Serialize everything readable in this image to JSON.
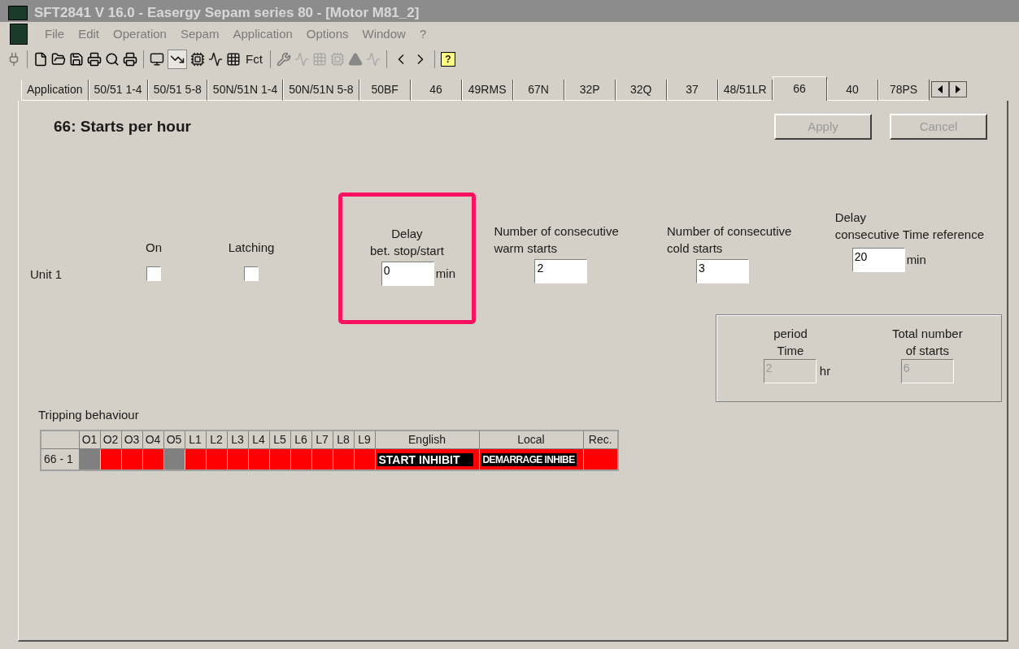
{
  "window": {
    "title": "SFT2841  V 16.0 - Easergy Sepam series 80 - [Motor M81_2]"
  },
  "menu": [
    "File",
    "Edit",
    "Operation",
    "Sepam",
    "Application",
    "Options",
    "Window",
    "?"
  ],
  "toolbar": {
    "fct_label": "Fct",
    "help_label": "?"
  },
  "tabs": [
    {
      "label": "Application",
      "selected": false
    },
    {
      "label": "50/51 1-4",
      "selected": false
    },
    {
      "label": "50/51 5-8",
      "selected": false
    },
    {
      "label": "50N/51N 1-4",
      "selected": false
    },
    {
      "label": "50N/51N 5-8",
      "selected": false
    },
    {
      "label": "50BF",
      "selected": false
    },
    {
      "label": "46",
      "selected": false
    },
    {
      "label": "49RMS",
      "selected": false
    },
    {
      "label": "67N",
      "selected": false
    },
    {
      "label": "32P",
      "selected": false
    },
    {
      "label": "32Q",
      "selected": false
    },
    {
      "label": "37",
      "selected": false
    },
    {
      "label": "48/51LR",
      "selected": false
    },
    {
      "label": "66",
      "selected": true
    },
    {
      "label": "40",
      "selected": false
    },
    {
      "label": "78PS",
      "selected": false
    }
  ],
  "heading": "66: Starts per hour",
  "buttons": [
    {
      "label": "Apply",
      "disabled": true
    },
    {
      "label": "Cancel",
      "disabled": true
    }
  ],
  "unit": {
    "label": "Unit 1"
  },
  "on": {
    "label": "On",
    "checked": false
  },
  "latching": {
    "label": "Latching",
    "checked": false
  },
  "delay_stop_start": {
    "label_lines": [
      "Delay",
      "bet. stop/start"
    ],
    "value": "0",
    "unit": "min",
    "highlighted": true
  },
  "warm_starts": {
    "label_lines": [
      "Number of consecutive",
      "warm starts"
    ],
    "value": "2"
  },
  "cold_starts": {
    "label_lines": [
      "Number of consecutive",
      "cold starts"
    ],
    "value": "3"
  },
  "delay_consecutive": {
    "label_lines": [
      "Delay",
      "consecutive Time reference"
    ],
    "value": "20",
    "unit": "min"
  },
  "summary": {
    "period": {
      "label_lines": [
        "period",
        "Time"
      ],
      "value": "2",
      "unit": "hr",
      "disabled": true
    },
    "total": {
      "label_lines": [
        "Total number",
        "of starts"
      ],
      "value": "6",
      "disabled": true
    }
  },
  "tripping": {
    "title": "Tripping behaviour",
    "columns": [
      "O1",
      "O2",
      "O3",
      "O4",
      "O5",
      "L1",
      "L2",
      "L3",
      "L4",
      "L5",
      "L6",
      "L7",
      "L8",
      "L9",
      "English",
      "Local",
      "Rec."
    ],
    "rows": [
      {
        "label": "66 - 1",
        "outputs": [
          {
            "color": "#808080"
          },
          {
            "color": "#ff0000"
          },
          {
            "color": "#ff0000"
          },
          {
            "color": "#ff0000"
          },
          {
            "color": "#808080"
          },
          {
            "color": "#ff0000"
          },
          {
            "color": "#ff0000"
          },
          {
            "color": "#ff0000"
          },
          {
            "color": "#ff0000"
          },
          {
            "color": "#ff0000"
          },
          {
            "color": "#ff0000"
          },
          {
            "color": "#ff0000"
          },
          {
            "color": "#ff0000"
          },
          {
            "color": "#ff0000"
          }
        ],
        "english": "START INHIBIT",
        "local": "DEMARRAGE INHIBE",
        "rec": {
          "color": "#ff0000"
        }
      }
    ]
  }
}
